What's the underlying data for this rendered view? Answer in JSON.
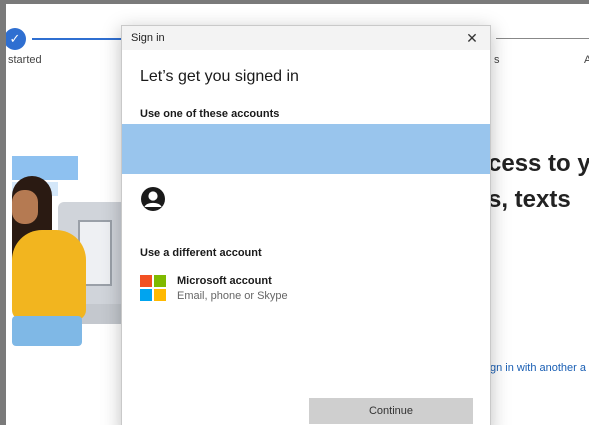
{
  "background": {
    "stepper": {
      "check_glyph": "✓",
      "step1_label": "started",
      "step2_label": "s",
      "step3_label": "A"
    },
    "heading_line1": "cess to y",
    "heading_line2": "s, texts",
    "link_text": "gn in with another a"
  },
  "dialog": {
    "title": "Sign in",
    "close_glyph": "✕",
    "heading": "Let’s get you signed in",
    "section_existing": "Use one of these accounts",
    "section_different": "Use a different account",
    "microsoft_account": {
      "name": "Microsoft account",
      "subtitle": "Email, phone or Skype"
    },
    "continue_label": "Continue"
  },
  "colors": {
    "accent": "#2f6fd1",
    "highlight": "#99c5ed",
    "ms_red": "#f25022",
    "ms_green": "#7fba00",
    "ms_blue": "#00a4ef",
    "ms_yellow": "#ffb900"
  },
  "icons": {
    "step_check": "checkmark-icon",
    "close": "close-icon",
    "person": "person-icon",
    "microsoft": "microsoft-logo-icon"
  }
}
